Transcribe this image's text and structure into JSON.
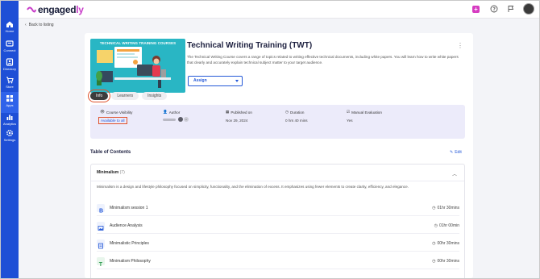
{
  "sidebar": {
    "items": [
      {
        "label": "Home",
        "icon": "home-icon"
      },
      {
        "label": "Connect",
        "icon": "connect-icon"
      },
      {
        "label": "Directory",
        "icon": "directory-icon"
      },
      {
        "label": "Store",
        "icon": "store-icon"
      },
      {
        "label": "Apps",
        "icon": "apps-icon"
      },
      {
        "label": "Analytics",
        "icon": "analytics-icon"
      },
      {
        "label": "Settings",
        "icon": "settings-icon"
      }
    ]
  },
  "topbar": {
    "logo_main": "engaged",
    "logo_accent": "ly"
  },
  "back_label": "Back to listing",
  "course": {
    "banner_title": "TECHNICAL WRITING TRAINING COURSES",
    "title": "Technical Writing Training (TWT)",
    "description": "The Technical Writing Course covers a range of topics related to writing effective technical documents, including white papers. You will learn how to write white papers that clearly and accurately explain technical subject matter to your target audience.",
    "assign_label": "Assign"
  },
  "tabs": [
    {
      "label": "Info"
    },
    {
      "label": "Learners"
    },
    {
      "label": "Insights"
    }
  ],
  "meta": {
    "visibility_label": "Course Visibility",
    "visibility_value": "Available to all",
    "author_label": "Author",
    "published_label": "Published on",
    "published_value": "Nov 29, 2024",
    "duration_label": "Duration",
    "duration_value": "0 hrs 40 mins",
    "evaluation_label": "Manual Evaluation",
    "evaluation_value": "Yes"
  },
  "toc": {
    "heading": "Table of Contents",
    "edit_label": "Edit",
    "section": {
      "title": "Minimalism",
      "count": "(7)",
      "description": "Minimalism is a design and lifestyle philosophy focused on simplicity, functionality, and the elimination of excess. It emphasizes using fewer elements to create clarity, efficiency, and elegance."
    },
    "lessons": [
      {
        "name": "Minimalism session 1",
        "duration": "01hr 30mins",
        "icon": "bold-text-icon"
      },
      {
        "name": "Audience Analysis",
        "duration": "01hr 00min",
        "icon": "image-icon"
      },
      {
        "name": "Minimalistic Principles",
        "duration": "00hr 30mins",
        "icon": "document-icon"
      },
      {
        "name": "Minimalism Philosophy",
        "duration": "00hr 30mins",
        "icon": "text-icon"
      }
    ]
  },
  "colors": {
    "sidebar": "#1e4fd6",
    "accent": "#2559d8",
    "brand_pink": "#c83ec9",
    "highlight": "#e0522c",
    "banner": "#29b6c4"
  }
}
